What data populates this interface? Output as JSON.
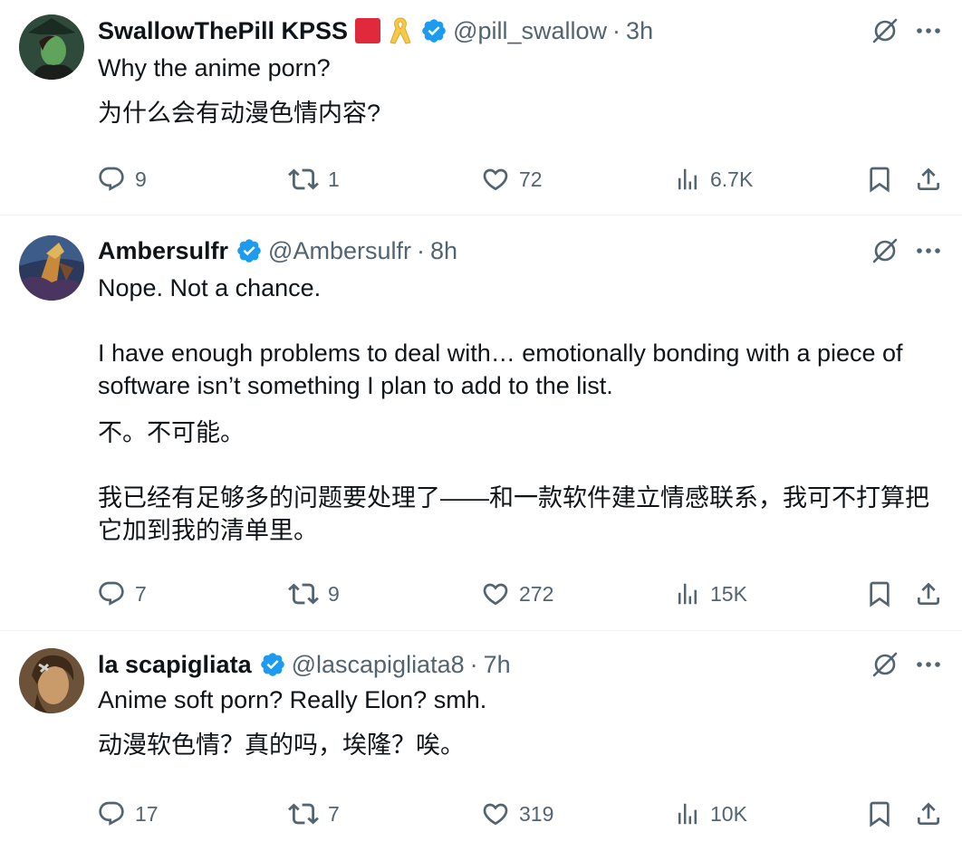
{
  "tweets": [
    {
      "name": "SwallowThePill KPSS",
      "handle": "@pill_swallow",
      "sep": "·",
      "time": "3h",
      "paragraphs": [
        "Why the anime porn?",
        "为什么会有动漫色情内容?"
      ],
      "replies": "9",
      "retweets": "1",
      "likes": "72",
      "views": "6.7K"
    },
    {
      "name": "Ambersulfr",
      "handle": "@Ambersulfr",
      "sep": "·",
      "time": "8h",
      "paragraphs": [
        "Nope. Not a chance.",
        "I have enough problems to deal with… emotionally bonding with a piece of software isn’t something I plan to add to the list.",
        "不。不可能。",
        "我已经有足够多的问题要处理了——和一款软件建立情感联系，我可不打算把它加到我的清单里。"
      ],
      "replies": "7",
      "retweets": "9",
      "likes": "272",
      "views": "15K"
    },
    {
      "name": "la scapigliata",
      "handle": "@lascapigliata8",
      "sep": "·",
      "time": "7h",
      "paragraphs": [
        "Anime soft porn? Really Elon? smh.",
        "动漫软色情？真的吗，埃隆？唉。"
      ],
      "replies": "17",
      "retweets": "7",
      "likes": "319",
      "views": "10K"
    }
  ],
  "icons": {
    "verified": "verified-badge-icon",
    "grok": "grok-icon",
    "more": "more-icon",
    "reply": "reply-icon",
    "retweet": "retweet-icon",
    "like": "heart-icon",
    "views": "views-icon",
    "bookmark": "bookmark-icon",
    "share": "share-icon"
  },
  "colors": {
    "text": "#0f1419",
    "secondary": "#536471",
    "verified": "#1d9bf0",
    "divider": "#eff3f4",
    "red_badge": "#e0293a",
    "yellow_ribbon": "#f7c948"
  }
}
